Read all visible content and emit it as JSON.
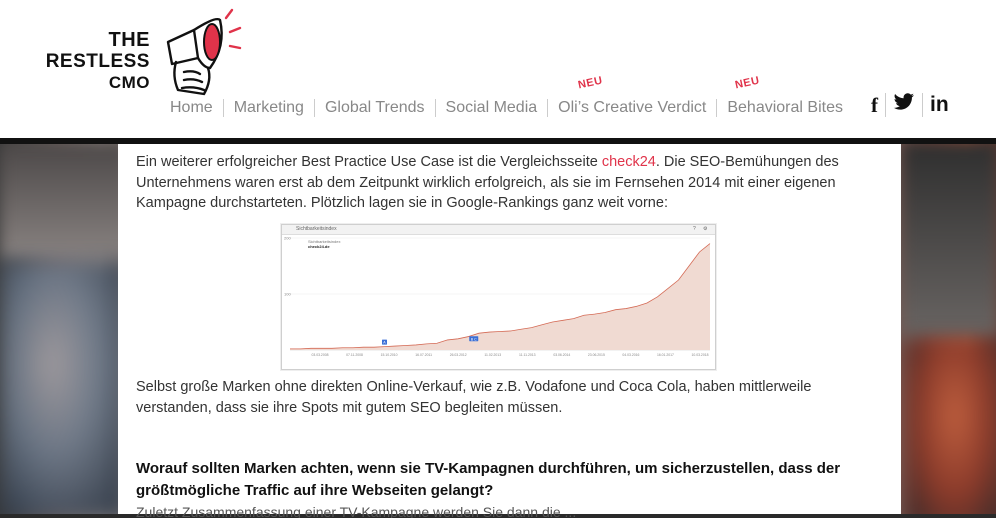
{
  "header": {
    "logo": {
      "line1": "THE",
      "line2": "RESTLESS",
      "line3": "CMO"
    },
    "nav": [
      {
        "label": "Home",
        "badge": ""
      },
      {
        "label": "Marketing",
        "badge": ""
      },
      {
        "label": "Global Trends",
        "badge": ""
      },
      {
        "label": "Social Media",
        "badge": ""
      },
      {
        "label": "Oli’s Creative Verdict",
        "badge": "NEU"
      },
      {
        "label": "Behavioral Bites",
        "badge": "NEU"
      }
    ],
    "social": {
      "facebook": "f",
      "twitter": "twitter-icon",
      "linkedin": "in"
    }
  },
  "article": {
    "p1_before": "Ein weiterer erfolgreicher Best Practice Use Case ist die Vergleichsseite ",
    "p1_link": "check24",
    "p1_after": ". Die SEO-Bemühungen des Unternehmens waren erst ab dem Zeitpunkt wirklich erfolgreich, als sie im Fernsehen 2014 mit einer eigenen Kampagne durchstarteten. Plötzlich lagen sie in Google-Rankings ganz weit vorne:",
    "p2": "Selbst große Marken ohne direkten Online-Verkauf, wie z.B. Vodafone und Coca Cola, haben mittlerweile verstanden, dass sie ihre Spots mit gutem SEO begleiten müssen.",
    "heading": "Worauf sollten Marken achten, wenn sie TV-Kampagnen durchführen, um sicherzustellen, dass der größtmögliche Traffic auf ihre Webseiten gelangt?",
    "cutoff": "Zuletzt Zusammenfassung einer TV-Kampagne werden Sie dann die ..."
  },
  "colors": {
    "accent": "#e0334a",
    "chart_fill": "#f0dad2",
    "chart_line": "#d46a55"
  },
  "chart_data": {
    "type": "area",
    "title": "Sichtbarkeitsindex",
    "legend": {
      "label": "Sichtbarkeitsindex",
      "name": "check24.de"
    },
    "ylim": [
      0,
      200
    ],
    "yticks": [
      "200",
      "100"
    ],
    "x_ticks": [
      "03.03.2008",
      "07.11.2008",
      "15.10.2010",
      "16.07.2011",
      "26.03.2012",
      "11.02.2013",
      "11.11.2013",
      "03.06.2014",
      "23.06.2015",
      "04.03.2016",
      "16.01.2017",
      "10.03.2018"
    ],
    "x": [
      0,
      1,
      2,
      3,
      4,
      5,
      6,
      7,
      8,
      9,
      10,
      11,
      12,
      13,
      14,
      15,
      16,
      17,
      18,
      19,
      20,
      21,
      22,
      23,
      24,
      25,
      26,
      27,
      28,
      29,
      30,
      31,
      32,
      33,
      34,
      35,
      36,
      37,
      38,
      39,
      40
    ],
    "values": [
      2,
      2,
      3,
      3,
      3,
      4,
      4,
      5,
      5,
      6,
      7,
      8,
      9,
      11,
      12,
      18,
      20,
      24,
      30,
      32,
      33,
      34,
      37,
      40,
      45,
      50,
      53,
      56,
      62,
      64,
      67,
      72,
      74,
      78,
      84,
      95,
      110,
      125,
      150,
      175,
      190
    ],
    "markers": [
      "A",
      "B C"
    ],
    "help_icon": "?",
    "settings_icon": "gear-icon"
  }
}
